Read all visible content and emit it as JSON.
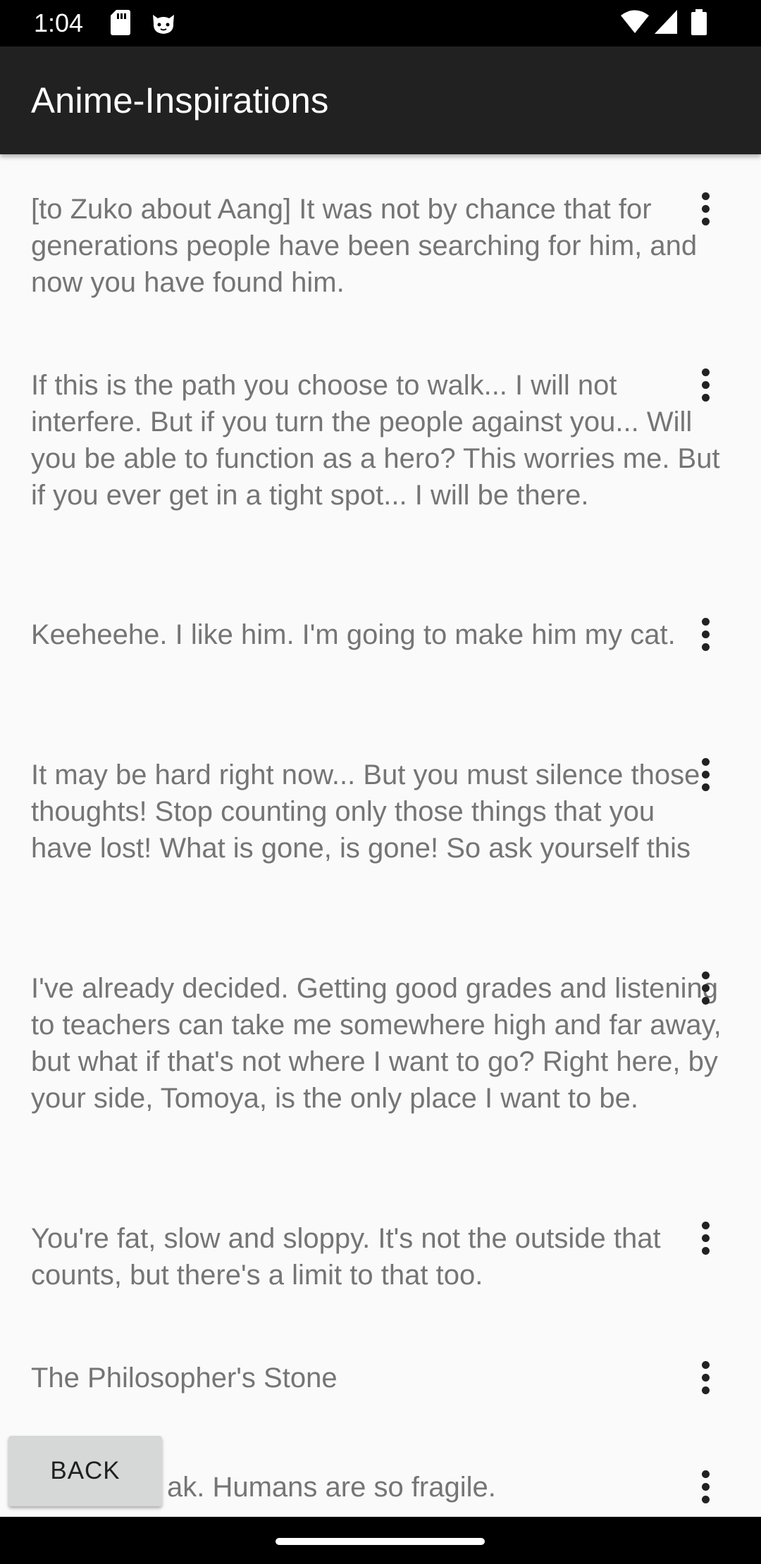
{
  "status_bar": {
    "time": "1:04",
    "left_icons": [
      "sd-card-icon",
      "cat-face-icon"
    ],
    "right_icons": [
      "wifi-icon",
      "signal-icon",
      "battery-icon"
    ]
  },
  "app_bar": {
    "title": "Anime-Inspirations"
  },
  "quotes": [
    {
      "text": "[to Zuko about Aang] It was not by chance that for generations people have been searching for him, and now you have found him."
    },
    {
      "text": "If this is the path you choose to walk... I will not interfere. But if you turn the people against you... Will you be able to function as a hero? This worries me. But if you ever get in a tight spot... I will be there."
    },
    {
      "text": "Keeheehe. I like him. I'm going to make him my cat."
    },
    {
      "text": "It may be hard right now... But you must silence those thoughts! Stop counting only those things that you have lost! What is gone, is gone! So ask yourself this"
    },
    {
      "text": "I've already decided. Getting good grades and listening to teachers can take me somewhere high and far away, but what if that's not where I want to go? Right here, by your side, Tomoya, is the only place I want to be."
    },
    {
      "text": "You're fat, slow and sloppy. It's not the outside that counts, but there's a limit to that too."
    },
    {
      "text": "The Philosopher's Stone"
    },
    {
      "text": "ak. Humans are so fragile."
    }
  ],
  "back_button": {
    "label": "BACK"
  }
}
